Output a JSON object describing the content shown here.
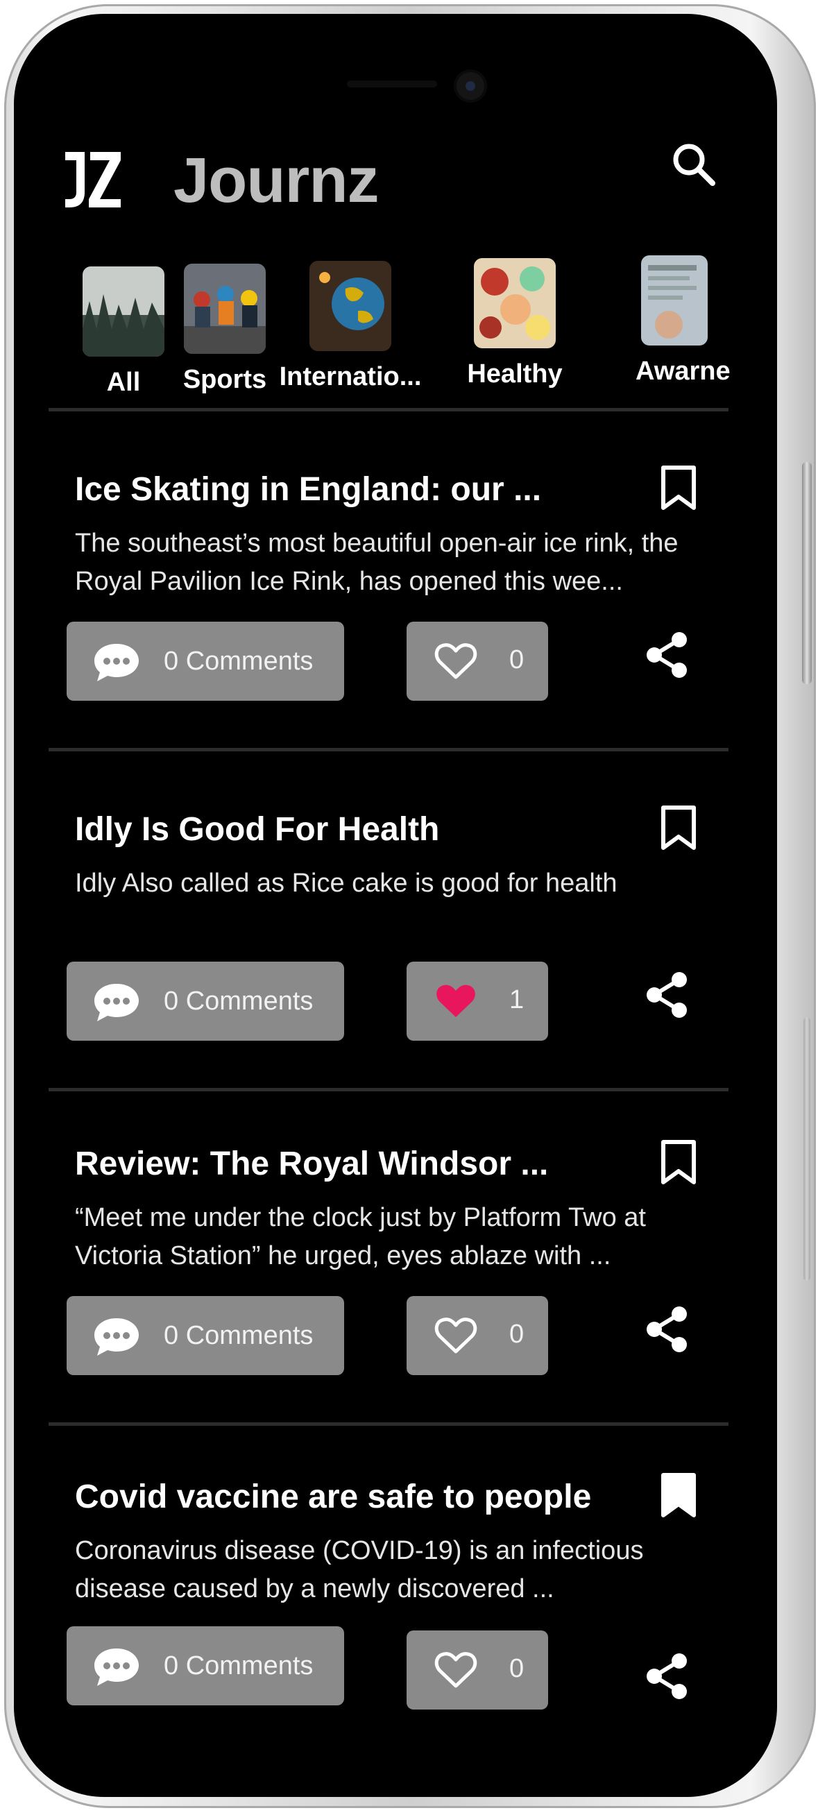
{
  "app": {
    "title": "Journz",
    "logo_text": "JZ",
    "search_icon": "search-icon"
  },
  "categories": [
    {
      "label": "All",
      "thumb": "forest"
    },
    {
      "label": "Sports",
      "thumb": "cyclists"
    },
    {
      "label": "Internatio...",
      "thumb": "globe"
    },
    {
      "label": "Healthy",
      "thumb": "food"
    },
    {
      "label": "Awarne",
      "thumb": "newspaper"
    }
  ],
  "articles": [
    {
      "title": "Ice Skating in England: our ...",
      "description": "The southeast’s most beautiful open-air ice rink, the Royal Pavilion Ice Rink, has opened this wee...",
      "bookmarked": false,
      "comments_label": "0 Comments",
      "likes": "0",
      "liked": false
    },
    {
      "title": "Idly Is Good For Health",
      "description": "Idly Also called as Rice cake is good for health",
      "bookmarked": false,
      "comments_label": "0 Comments",
      "likes": "1",
      "liked": true
    },
    {
      "title": "Review: The Royal Windsor ...",
      "description": "“Meet me under the clock just by Platform Two at Victoria Station” he urged, eyes ablaze with ...",
      "bookmarked": false,
      "comments_label": "0 Comments",
      "likes": "0",
      "liked": false
    },
    {
      "title": "Covid vaccine are safe to people",
      "description": "Coronavirus disease (COVID-19) is an infectious disease caused by a newly discovered ...",
      "bookmarked": true,
      "comments_label": "0 Comments",
      "likes": "0",
      "liked": false
    }
  ],
  "colors": {
    "background": "#000000",
    "button": "#8a8a8a",
    "title_gray": "#bdbdbd",
    "heart_active": "#e8175d"
  }
}
